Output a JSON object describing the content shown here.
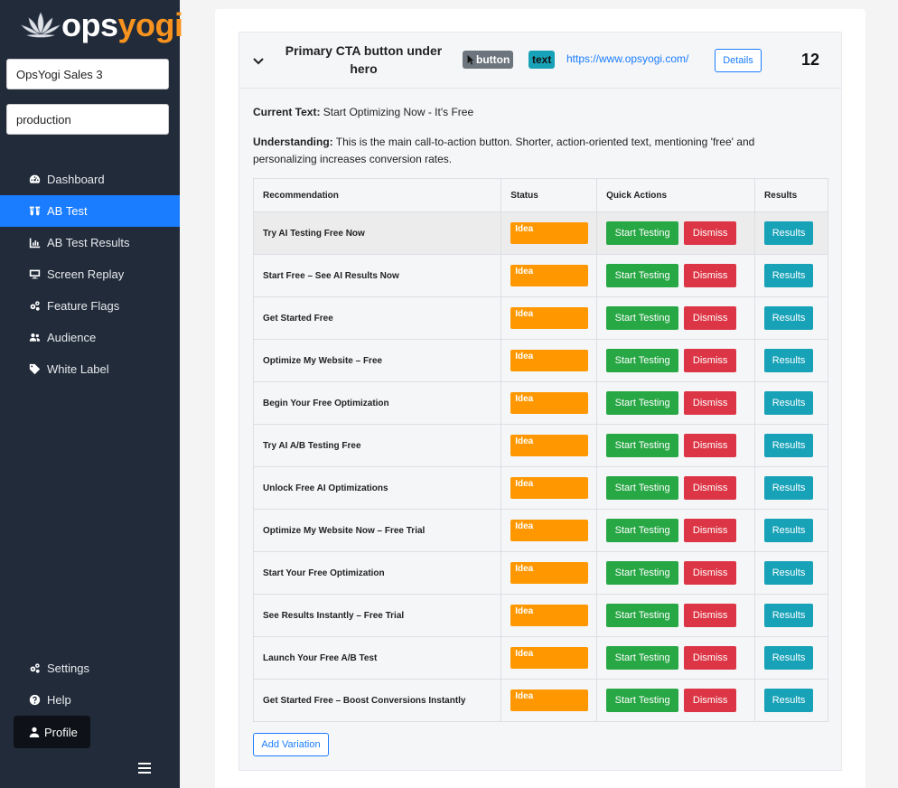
{
  "brand": {
    "logo_text_1": "ops",
    "logo_text_2": "yogi"
  },
  "sidebar": {
    "project": "OpsYogi Sales 3",
    "environment": "production",
    "items": [
      {
        "label": "Dashboard",
        "icon": "dashboard-icon",
        "active": false
      },
      {
        "label": "AB Test",
        "icon": "flask-icon",
        "active": true
      },
      {
        "label": "AB Test Results",
        "icon": "bar-chart-icon",
        "active": false
      },
      {
        "label": "Screen Replay",
        "icon": "monitor-icon",
        "active": false
      },
      {
        "label": "Feature Flags",
        "icon": "cogs-icon",
        "active": false
      },
      {
        "label": "Audience",
        "icon": "users-icon",
        "active": false
      },
      {
        "label": "White Label",
        "icon": "tag-icon",
        "active": false
      }
    ],
    "bottom": [
      {
        "label": "Settings",
        "icon": "cogs-icon"
      },
      {
        "label": "Help",
        "icon": "question-icon"
      }
    ],
    "profile_label": "Profile"
  },
  "element": {
    "title": "Primary CTA button under hero",
    "type_badge": "button",
    "content_badge": "text",
    "url": "https://www.opsyogi.com/",
    "details_label": "Details",
    "count": "12",
    "current_text_label": "Current Text:",
    "current_text": "Start Optimizing Now - It's Free",
    "understanding_label": "Understanding:",
    "understanding": "This is the main call-to-action button. Shorter, action-oriented text, mentioning 'free' and personalizing increases conversion rates."
  },
  "table": {
    "headers": [
      "Recommendation",
      "Status",
      "Quick Actions",
      "Results"
    ],
    "start_label": "Start Testing",
    "dismiss_label": "Dismiss",
    "results_label": "Results",
    "rows": [
      {
        "text": "Try AI Testing Free Now",
        "status": "Idea"
      },
      {
        "text": "Start Free – See AI Results Now",
        "status": "Idea"
      },
      {
        "text": "Get Started Free",
        "status": "Idea"
      },
      {
        "text": "Optimize My Website – Free",
        "status": "Idea"
      },
      {
        "text": "Begin Your Free Optimization",
        "status": "Idea"
      },
      {
        "text": "Try AI A/B Testing Free",
        "status": "Idea"
      },
      {
        "text": "Unlock Free AI Optimizations",
        "status": "Idea"
      },
      {
        "text": "Optimize My Website Now – Free Trial",
        "status": "Idea"
      },
      {
        "text": "Start Your Free Optimization",
        "status": "Idea"
      },
      {
        "text": "See Results Instantly – Free Trial",
        "status": "Idea"
      },
      {
        "text": "Launch Your Free A/B Test",
        "status": "Idea"
      },
      {
        "text": "Get Started Free – Boost Conversions Instantly",
        "status": "Idea"
      }
    ]
  },
  "add_variation_label": "Add Variation",
  "colors": {
    "accent": "#1a7cff",
    "sidebar": "#212b3a",
    "idea": "#ff9800",
    "start": "#28a745",
    "dismiss": "#dc3545",
    "results": "#17a2b8",
    "logo_orange": "#f7931e"
  }
}
